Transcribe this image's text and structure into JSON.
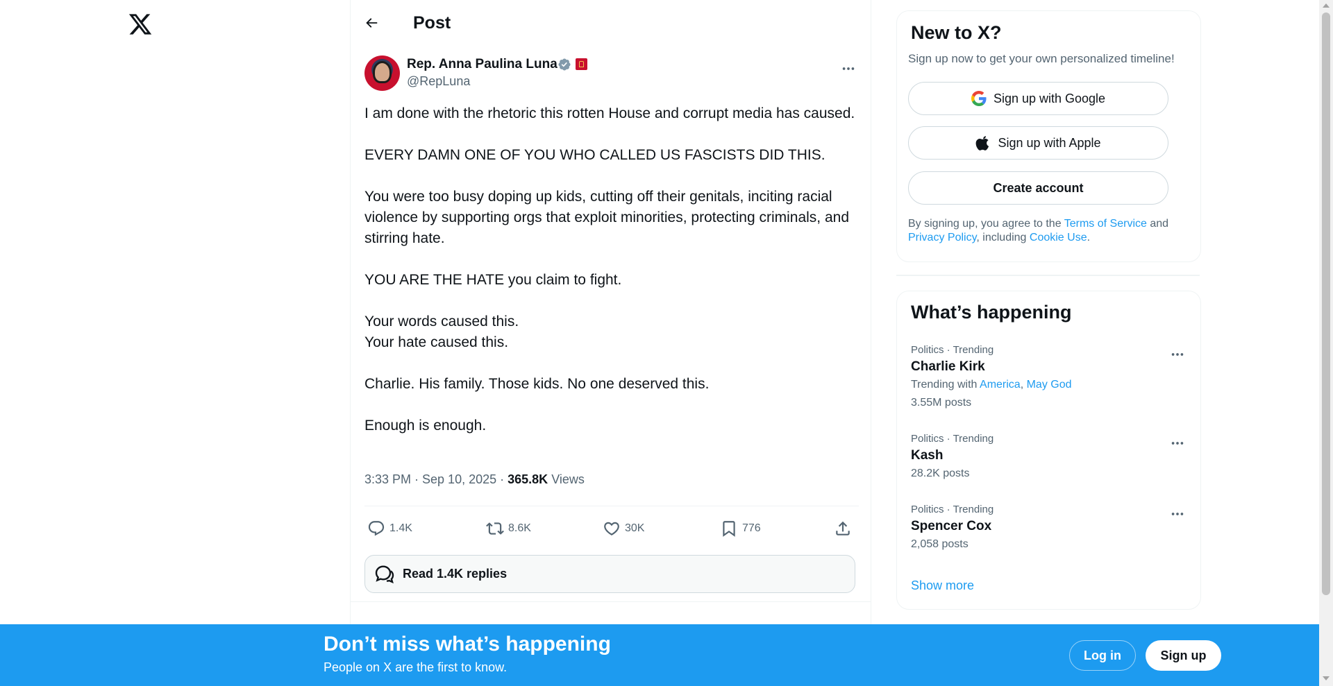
{
  "header": {
    "title": "Post"
  },
  "post": {
    "author_name": "Rep. Anna Paulina Luna",
    "author_handle": "@RepLuna",
    "paragraphs": [
      "I am done with the rhetoric this rotten House and corrupt media has caused.",
      "EVERY DAMN ONE OF YOU WHO CALLED US FASCISTS DID THIS.",
      "You were too busy doping up kids, cutting off their genitals, inciting racial violence by supporting orgs that exploit minorities, protecting criminals, and stirring hate.",
      "YOU ARE THE HATE you claim to fight."
    ],
    "words_line": "Your words caused this.",
    "hate_line": "Your hate caused this.",
    "charlie_line": "Charlie. His family. Those kids. No one deserved this.",
    "closing_line": "Enough is enough.",
    "timestamp": "3:33 PM · Sep 10, 2025",
    "views_count": "365.8K",
    "views_label": "Views",
    "stats": {
      "replies": "1.4K",
      "reposts": "8.6K",
      "likes": "30K",
      "bookmarks": "776"
    },
    "read_replies_label": "Read 1.4K replies"
  },
  "signup_card": {
    "title": "New to X?",
    "subtitle": "Sign up now to get your own personalized timeline!",
    "google_label": "Sign up with Google",
    "apple_label": "Sign up with Apple",
    "create_label": "Create account",
    "legal_prefix": "By signing up, you agree to the",
    "terms_link": "Terms of Service",
    "legal_and": "and",
    "privacy_link": "Privacy Policy",
    "legal_including": ", including",
    "cookie_link": "Cookie Use",
    "legal_end": "."
  },
  "trends": {
    "title": "What’s happening",
    "items": [
      {
        "category": "Politics · Trending",
        "name": "Charlie Kirk",
        "trending_with_label": "Trending with",
        "related": [
          "America",
          "May God"
        ],
        "count": "3.55M posts"
      },
      {
        "category": "Politics · Trending",
        "name": "Kash",
        "count": "28.2K posts"
      },
      {
        "category": "Politics · Trending",
        "name": "Spencer Cox",
        "count": "2,058 posts"
      }
    ],
    "show_more": "Show more"
  },
  "banner": {
    "title": "Don’t miss what’s happening",
    "subtitle": "People on X are the first to know.",
    "login_label": "Log in",
    "signup_label": "Sign up"
  },
  "colors": {
    "accent": "#1d9bf0",
    "text": "#0f1419",
    "secondary": "#536471",
    "border": "#eff3f4"
  },
  "icons": [
    "x-logo-icon",
    "back-arrow-icon",
    "verified-badge-icon",
    "flag-badge-icon",
    "more-dots-icon",
    "reply-icon",
    "repost-icon",
    "like-icon",
    "bookmark-icon",
    "share-icon",
    "replies-bubbles-icon",
    "google-icon",
    "apple-icon"
  ]
}
